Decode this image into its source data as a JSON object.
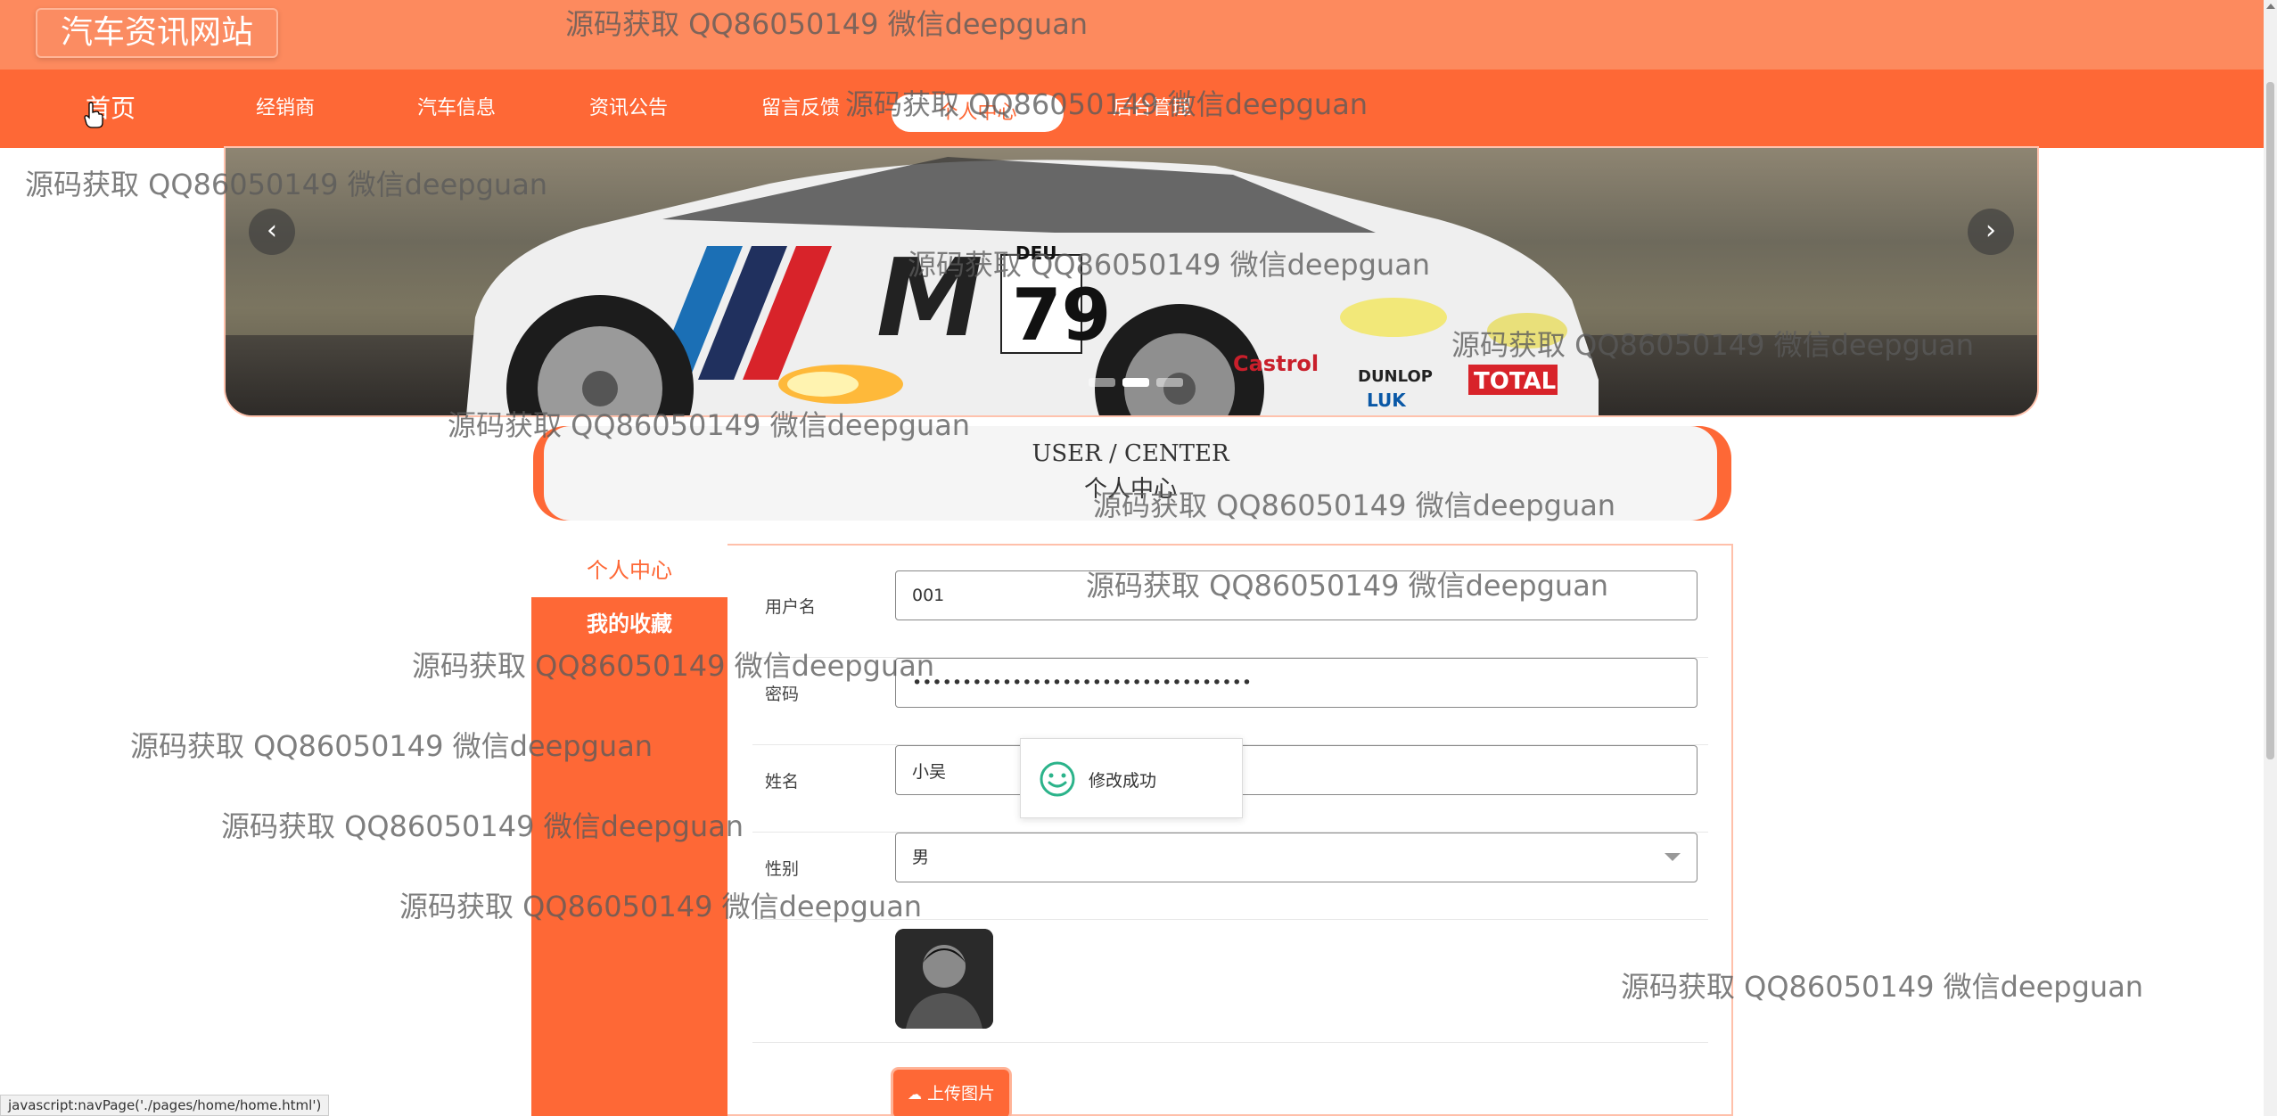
{
  "header": {
    "site_title": "汽车资讯网站"
  },
  "nav": {
    "items": [
      {
        "label": "首页"
      },
      {
        "label": "经销商"
      },
      {
        "label": "汽车信息"
      },
      {
        "label": "资讯公告"
      },
      {
        "label": "留言反馈"
      },
      {
        "label": "个人中心"
      },
      {
        "label": "后台管理"
      }
    ],
    "active": "个人中心"
  },
  "banner": {
    "prev_icon": "chevron-left-icon",
    "next_icon": "chevron-right-icon",
    "slide_count": 3,
    "active_slide": 1,
    "car_number": "79",
    "car_flag_text": "DEU",
    "sponsor_castrol": "Castrol",
    "sponsor_dunlop": "DUNLOP",
    "sponsor_total": "TOTAL",
    "sponsor_luk": "LUK"
  },
  "section": {
    "title_en": "USER / CENTER",
    "title_cn": "个人中心"
  },
  "side_menu": {
    "items": [
      {
        "label": "个人中心"
      },
      {
        "label": "我的收藏"
      }
    ]
  },
  "form": {
    "username_label": "用户名",
    "username_value": "001",
    "password_label": "密码",
    "password_value": "••••••••••••••••••••••••••••••••••",
    "name_label": "姓名",
    "name_value": "小吴",
    "gender_label": "性别",
    "gender_value": "男",
    "upload_label": "上传图片"
  },
  "toast": {
    "message": "修改成功",
    "icon": "smile-icon"
  },
  "status_bar": {
    "text": "javascript:navPage('./pages/home/home.html')"
  },
  "watermark": {
    "text": "源码获取 QQ86050149 微信deepguan"
  },
  "colors": {
    "header_bg": "#fd8a5e",
    "nav_bg": "#fe6836",
    "accent": "#fe6836",
    "success": "#2bb38a"
  }
}
